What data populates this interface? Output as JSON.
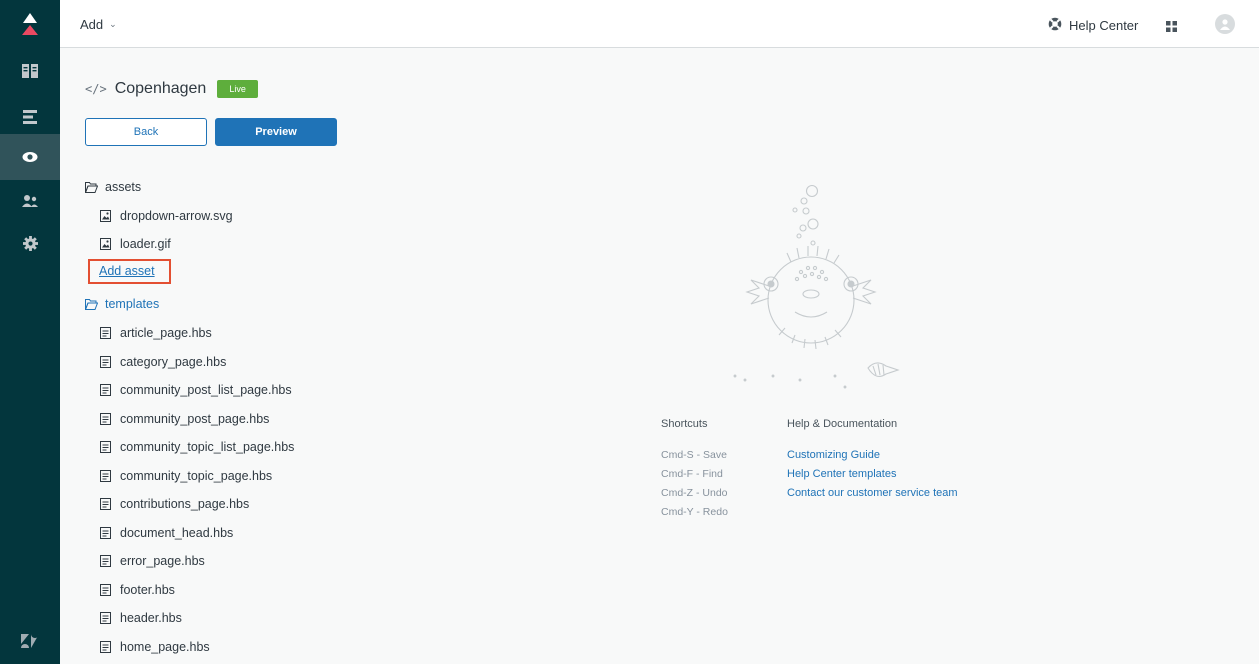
{
  "topbar": {
    "add_label": "Add",
    "help_center_label": "Help Center"
  },
  "sidebar": {
    "items": [
      {
        "icon": "zendesk-guide-logo-icon"
      },
      {
        "icon": "knowledge-base-icon"
      },
      {
        "icon": "arrange-content-icon"
      },
      {
        "icon": "customize-design-icon",
        "active": true
      },
      {
        "icon": "user-permissions-icon"
      },
      {
        "icon": "settings-gear-icon"
      },
      {
        "icon": "zendesk-logo-icon"
      }
    ]
  },
  "theme": {
    "name": "Copenhagen",
    "status": "Live"
  },
  "buttons": {
    "back": "Back",
    "preview": "Preview"
  },
  "tree": {
    "assets_folder": "assets",
    "assets": [
      "dropdown-arrow.svg",
      "loader.gif"
    ],
    "add_asset": "Add asset",
    "templates_folder": "templates",
    "templates": [
      "article_page.hbs",
      "category_page.hbs",
      "community_post_list_page.hbs",
      "community_post_page.hbs",
      "community_topic_list_page.hbs",
      "community_topic_page.hbs",
      "contributions_page.hbs",
      "document_head.hbs",
      "error_page.hbs",
      "footer.hbs",
      "header.hbs",
      "home_page.hbs"
    ]
  },
  "shortcuts": {
    "title": "Shortcuts",
    "items": [
      "Cmd-S - Save",
      "Cmd-F - Find",
      "Cmd-Z - Undo",
      "Cmd-Y - Redo"
    ]
  },
  "help_docs": {
    "title": "Help & Documentation",
    "links": [
      "Customizing Guide",
      "Help Center templates",
      "Contact our customer service team"
    ]
  },
  "colors": {
    "sidebar_bg": "#03363d",
    "accent_blue": "#1f73b7",
    "live_green": "#5eae3c",
    "highlight_red": "#e34f32"
  }
}
